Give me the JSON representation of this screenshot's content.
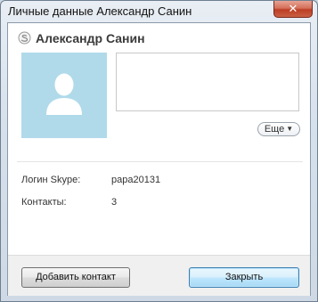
{
  "window": {
    "title": "Личные данные Александр Санин",
    "close_glyph": "✕"
  },
  "profile": {
    "status_icon": "skype-status-icon",
    "name": "Александр Санин",
    "avatar_icon": "person-silhouette-icon",
    "mood_text": "",
    "more_label": "Еще",
    "more_icon": "chevron-down-icon"
  },
  "fields": [
    {
      "label": "Логин Skype:",
      "value": "papa20131"
    },
    {
      "label": "Контакты:",
      "value": "3"
    }
  ],
  "footer": {
    "add_contact_label": "Добавить контакт",
    "close_label": "Закрыть"
  },
  "colors": {
    "avatar_bg": "#b0daea",
    "primary_button": "#a7d9f5",
    "close_button": "#c95f44"
  }
}
